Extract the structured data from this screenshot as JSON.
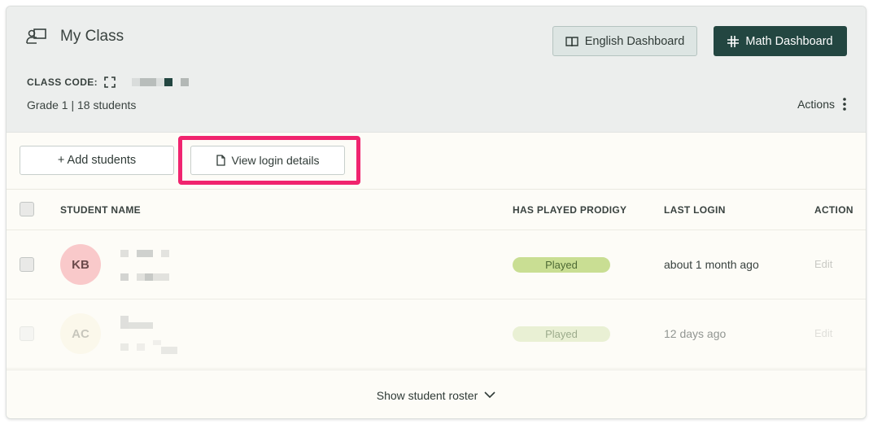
{
  "header": {
    "title": "My Class",
    "class_code_label": "CLASS CODE:",
    "grade_info": "Grade 1 | 18 students",
    "actions_label": "Actions"
  },
  "dashboards": {
    "english_label": "English Dashboard",
    "math_label": "Math Dashboard"
  },
  "toolbar": {
    "add_students_label": "+ Add students",
    "view_login_label": "View login details"
  },
  "table": {
    "columns": [
      "STUDENT NAME",
      "HAS PLAYED PRODIGY",
      "LAST LOGIN",
      "ACTION"
    ],
    "rows": [
      {
        "initials": "KB",
        "status": "Played",
        "last_login": "about 1 month ago",
        "action": "Edit"
      },
      {
        "initials": "AC",
        "status": "Played",
        "last_login": "12 days ago",
        "action": "Edit"
      }
    ]
  },
  "footer": {
    "show_roster_label": "Show student roster"
  },
  "colors": {
    "math_button_bg": "#234641",
    "highlight": "#f0246e",
    "played_badge": "#c9de93",
    "avatar_kb": "#f9c9ca"
  },
  "icons": {
    "class": "teacher-board-icon",
    "code": "fullscreen-icon",
    "english": "book-icon",
    "math": "math-grid-icon",
    "actions": "vertical-dots-icon",
    "view_login": "document-icon",
    "footer": "chevron-down-icon"
  }
}
